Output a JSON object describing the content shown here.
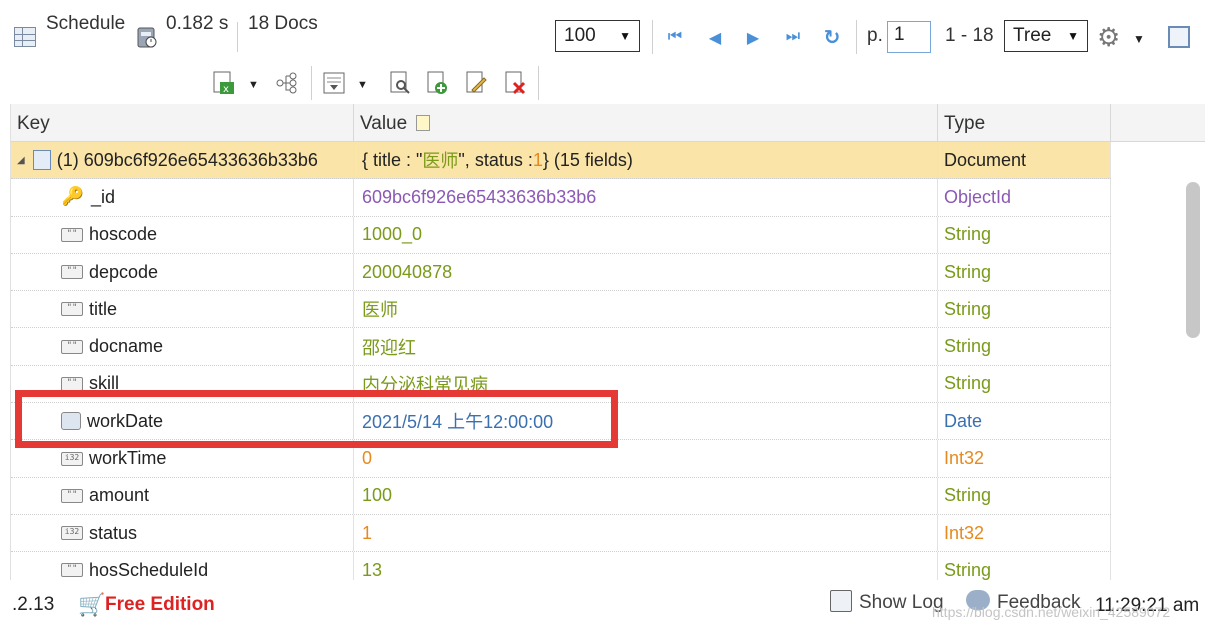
{
  "toolbar": {
    "view_label": "Schedule",
    "time": "0.182 s",
    "docs": "18 Docs",
    "page_size": "100",
    "page_prefix": "p.",
    "page_value": "1",
    "range": "1 - 18",
    "view_mode": "Tree"
  },
  "grid": {
    "headers": {
      "key": "Key",
      "value": "Value",
      "type": "Type"
    },
    "document": {
      "key": "(1) 609bc6f926e65433636b33b6",
      "value_open": "{ title : \"",
      "value_title": "医师",
      "value_mid": "\", status : ",
      "value_status": "1",
      "value_close": " } (15 fields)",
      "type": "Document"
    },
    "fields": [
      {
        "key": "_id",
        "value": "609bc6f926e65433636b33b6",
        "type": "ObjectId",
        "icon": "key-icon",
        "color": "purple"
      },
      {
        "key": "hoscode",
        "value": "1000_0",
        "type": "String",
        "icon": "string-icon",
        "color": "green"
      },
      {
        "key": "depcode",
        "value": "200040878",
        "type": "String",
        "icon": "string-icon",
        "color": "green"
      },
      {
        "key": "title",
        "value": "医师",
        "type": "String",
        "icon": "string-icon",
        "color": "green"
      },
      {
        "key": "docname",
        "value": "邵迎红",
        "type": "String",
        "icon": "string-icon",
        "color": "green"
      },
      {
        "key": "skill",
        "value": "内分泌科常见病",
        "type": "String",
        "icon": "string-icon",
        "color": "green"
      },
      {
        "key": "workDate",
        "value": "2021/5/14 上午12:00:00",
        "type": "Date",
        "icon": "date-icon",
        "color": "blue"
      },
      {
        "key": "workTime",
        "value": "0",
        "type": "Int32",
        "icon": "int32-icon",
        "color": "orange"
      },
      {
        "key": "amount",
        "value": "100",
        "type": "String",
        "icon": "string-icon",
        "color": "green"
      },
      {
        "key": "status",
        "value": "1",
        "type": "Int32",
        "icon": "int32-icon",
        "color": "orange"
      },
      {
        "key": "hosScheduleId",
        "value": "13",
        "type": "String",
        "icon": "string-icon",
        "color": "green"
      }
    ]
  },
  "statusbar": {
    "version": ".2.13",
    "edition": "Free Edition",
    "show_log": "Show Log",
    "feedback": "Feedback",
    "time": "11:29:21 am"
  },
  "watermark": "https://blog.csdn.net/weixin_42589072",
  "colors": {
    "doc_row": "#fbe4a8",
    "highlight": "#e53935",
    "string": "#7a9a1a",
    "objectid": "#8c58b5",
    "date": "#3a6fb0",
    "int": "#e58a1f"
  }
}
